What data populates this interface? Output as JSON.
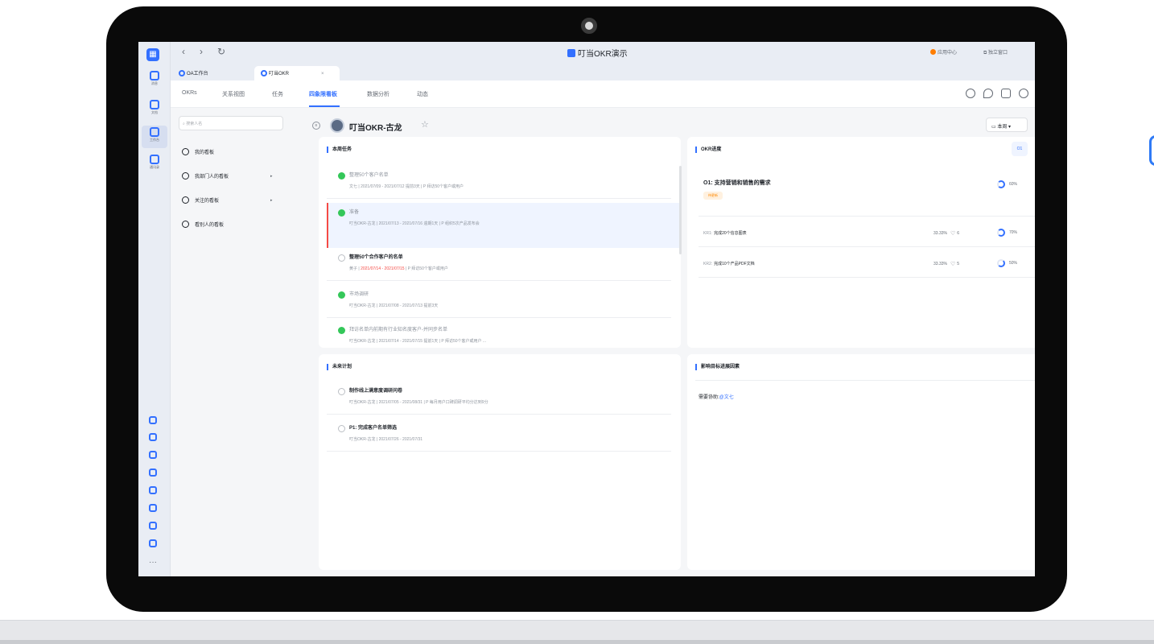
{
  "window": {
    "title": "叮当OKR演示",
    "app_center": "应用中心",
    "standalone": "独立窗口"
  },
  "rail": {
    "items": [
      {
        "label": "消息"
      },
      {
        "label": "文档"
      },
      {
        "label": "工作台"
      },
      {
        "label": "通讯录"
      }
    ],
    "more": "···"
  },
  "browser_tabs": [
    {
      "label": "OA工作台"
    },
    {
      "label": "叮当OKR",
      "close": "×"
    }
  ],
  "nav": {
    "items": [
      "OKRs",
      "关系视图",
      "任务",
      "四象限看板",
      "数据分析",
      "动态"
    ],
    "active": "四象限看板"
  },
  "sidebar": {
    "search_placeholder": "搜索人名",
    "items": [
      {
        "label": "我的看板"
      },
      {
        "label": "我部门人的看板",
        "caret": "▸"
      },
      {
        "label": "关注的看板",
        "caret": "▸"
      },
      {
        "label": "看别人的看板"
      }
    ]
  },
  "header": {
    "board_title": "叮当OKR-古龙",
    "week_button": "本周"
  },
  "week_tasks": {
    "title": "本周任务",
    "items": [
      {
        "name": "整理50个客户名单",
        "done": true,
        "meta": "文七  |  2021/07/09 - 2021/07/12 提前3天  |  P 拜访50个客户或用户"
      },
      {
        "name": "准备",
        "done": true,
        "meta": "叮当OKR-古龙  |  2021/07/13 - 2021/07/16 逾期1天  |  P 组织5次产品发布会"
      },
      {
        "name": "整理50个合作客户的名单",
        "done": false,
        "owner": "黄子",
        "date": "2021/07/14 - 2021/07/15",
        "plan": "P 拜访50个客户或用户"
      },
      {
        "name": "市场调研",
        "done": true,
        "meta": "叮当OKR-古龙  |  2021/07/08 - 2021/07/13 提前3天"
      },
      {
        "name": "拜访名单内前期有行业知名度客户-并同步名单",
        "done": true,
        "meta": "叮当OKR-古龙  |  2021/07/14 - 2021/07/15 提前1天  |  P 拜访50个客户或用户 ..."
      }
    ]
  },
  "okr_progress": {
    "title": "OKR进度",
    "badge": "O1",
    "objective": "O1: 支持营销和销售的需求",
    "tag": "待更新",
    "objective_pct": "60%",
    "objective_progress": 0.6,
    "krs": [
      {
        "id": "KR1:",
        "name": "完成20个信息图表",
        "weight": "33.33%",
        "likes": "6",
        "pct": "70%",
        "progress": 0.7
      },
      {
        "id": "KR2:",
        "name": "完成10个产品PDF文档",
        "weight": "33.33%",
        "likes": "5",
        "pct": "50%",
        "progress": 0.5
      }
    ]
  },
  "future_plans": {
    "title": "未来计划",
    "items": [
      {
        "name": "制作线上满意度调研问卷",
        "meta": "叮当OKR-古龙  |  2021/07/05 - 2021/08/31  |  P 每月用户口碑调研平均分达到9分"
      },
      {
        "name": "P1: 完成客户名单筛选",
        "meta": "叮当OKR-古龙  |  2021/07/26 - 2021/07/31"
      }
    ]
  },
  "impact": {
    "title": "影响目标进展因素",
    "assist_label": "需要协助:",
    "assist_person": "@文七"
  },
  "colors": {
    "accent": "#3370ff",
    "done": "#34c759",
    "danger": "#f54a45",
    "tag_bg": "#fff1e0",
    "tag_text": "#ff8800"
  }
}
